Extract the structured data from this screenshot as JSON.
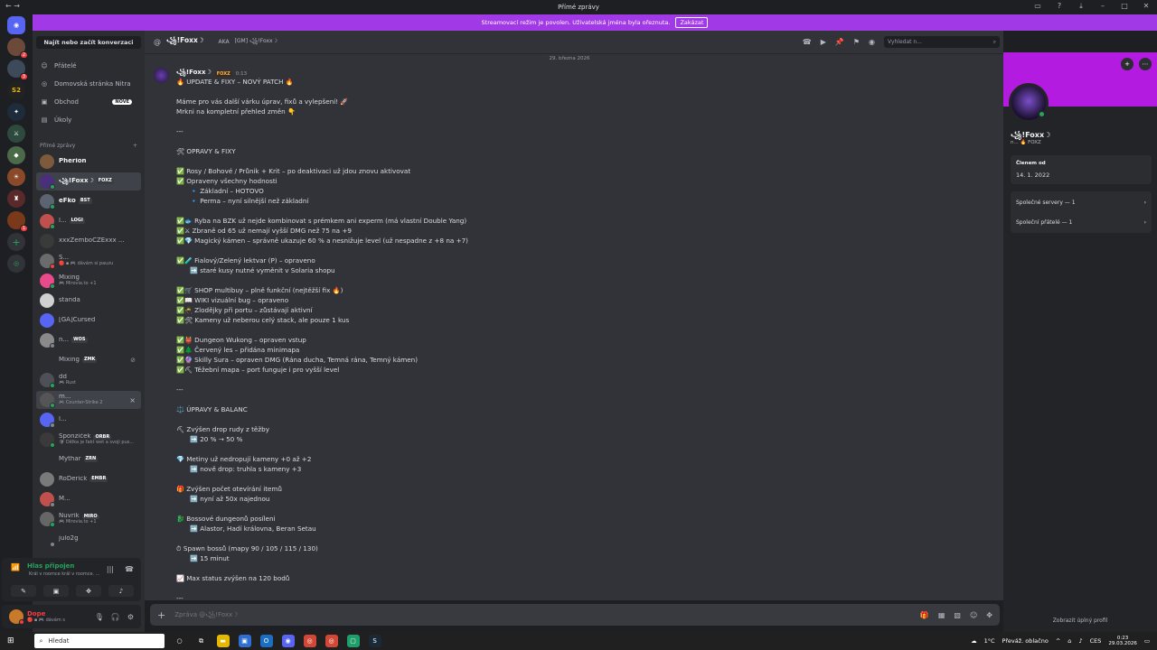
{
  "window": {
    "title": "Přímé zprávy"
  },
  "banner": {
    "text": "Streamovací režim je povolen. Uživatelská jména byla ořeznuta.",
    "button": "Zakázat"
  },
  "dm_sidebar": {
    "search": "Najít nebo začít konverzaci",
    "nav": [
      {
        "label": "Přátelé",
        "icon": "friends-icon"
      },
      {
        "label": "Domovská stránka Nitra",
        "icon": "nitro-icon"
      },
      {
        "label": "Obchod",
        "icon": "shop-icon",
        "badge": "NOVÉ"
      },
      {
        "label": "Úkoly",
        "icon": "quests-icon"
      }
    ],
    "header": "Přímé zprávy",
    "header_plus": "+",
    "dms": [
      {
        "name": "Pherion",
        "bright": true,
        "color": "#7d5a3c",
        "status": "none"
      },
      {
        "name": "꧁!Foxx☽",
        "tag": "FOXZ",
        "selected": true,
        "bright": true,
        "color": "#4a2f7a",
        "status": "online"
      },
      {
        "name": "eFko",
        "tag": "BST",
        "bright": true,
        "color": "#5b6470",
        "status": "online"
      },
      {
        "name": "l...",
        "tag": "LOGI",
        "color": "#c0504d",
        "status": "online"
      },
      {
        "name": "xxxZemboCZExxx ...",
        "color": "#3a3a3a",
        "status": "none"
      },
      {
        "name": "S...",
        "sub": "🔴 ▪ 🎮 dávám si pauzu",
        "color": "#6b6b6b",
        "status": "dnd"
      },
      {
        "name": "Mixing",
        "sub": "🎮 Mirovia.to +1",
        "color": "#e84a8a",
        "status": "online"
      },
      {
        "name": "standa",
        "color": "#d0d0d0",
        "status": "none"
      },
      {
        "name": "[GA]Cursed",
        "color": "#5865f2",
        "status": "none"
      },
      {
        "name": "n...",
        "tag": "WOS",
        "color": "#8a8a8a",
        "status": "offline"
      },
      {
        "name": "Mixing",
        "tag": "ZMK",
        "color": "#2b2d31",
        "status": "none",
        "muted": true
      },
      {
        "name": "dd",
        "sub": "🎮 Rust",
        "color": "#4e5058",
        "status": "online"
      },
      {
        "name": "m...",
        "sub": "🎮 Counter-Strike 2",
        "color": "#555",
        "status": "online",
        "hover": true,
        "close": "×"
      },
      {
        "name": "l...",
        "color": "#5865f2",
        "status": "offline"
      },
      {
        "name": "Sponzíček",
        "tag": "ORBR",
        "sub": "🛡 Dělka je fakt wet a svoji pus...",
        "color": "#3a3a3a",
        "status": "online"
      },
      {
        "name": "Mythar",
        "tag": "ZRN",
        "color": "#2b2d31",
        "status": "none"
      },
      {
        "name": "RoDerick",
        "tag": "EMBR",
        "color": "#7a7a7a",
        "status": "none"
      },
      {
        "name": "M...",
        "color": "#c0504d",
        "status": "offline"
      },
      {
        "name": "Nuvrik",
        "tag": "MIRO",
        "sub": "🎮 Mirovia.to +1",
        "color": "#666",
        "status": "online"
      },
      {
        "name": "julo2g",
        "color": "#2b2d31",
        "status": "offline"
      }
    ]
  },
  "voice": {
    "title": "Hlas připojen",
    "sub": "Král v roomce král v roomce. ..."
  },
  "user": {
    "name": "Dope",
    "status": "🔴 ▪ 🎮 dávám s"
  },
  "chat_header": {
    "name": "꧁!Foxx☽",
    "aka_label": "AKA",
    "aka_value": "[GM] ꧁!Foxx☽",
    "search": "Vyhledat n..."
  },
  "message": {
    "date": "29. března 2026",
    "author": "꧁!Foxx☽",
    "tag": "FOXZ",
    "time": "0:13",
    "lines": [
      {
        "t": "🔥 UPDATE & FIXY – NOVÝ PATCH 🔥"
      },
      {
        "t": ""
      },
      {
        "t": "Máme pro vás další várku úprav, fixů a vylepšení! 🚀"
      },
      {
        "t": "Mrkni na kompletní přehled změn 👇"
      },
      {
        "t": ""
      },
      {
        "t": "---"
      },
      {
        "t": ""
      },
      {
        "t": "🛠 OPRAVY & FIXY"
      },
      {
        "t": ""
      },
      {
        "t": "✅ Rosy / Bohové / Průnik + Krit – po deaktivaci už jdou znovu aktivovat"
      },
      {
        "t": "✅ Opraveny všechny hodnosti"
      },
      {
        "t": "🔹 Základní – HOTOVO",
        "ind": true
      },
      {
        "t": "🔹 Perma – nyní silnější než základní",
        "ind": true
      },
      {
        "t": ""
      },
      {
        "t": "✅🐟 Ryba na BZK už nejde kombinovat s prémkem ani experm (má vlastní Double Yang)"
      },
      {
        "t": "✅⚔ Zbraně od 65 už nemají vyšší DMG než 75 na +9"
      },
      {
        "t": "✅💎 Magický kámen – správně ukazuje 60 % a nesnižuje level (už nespadne z +8 na +7)"
      },
      {
        "t": ""
      },
      {
        "t": "✅🧪 Fialový/Zelený lektvar (P) – opraveno"
      },
      {
        "t": "➡️ staré kusy nutné vyměnit v Solaria shopu",
        "ind": true
      },
      {
        "t": ""
      },
      {
        "t": "✅🛒 SHOP multibuy – plně funkční (nejtěžší fix 🔥)"
      },
      {
        "t": "✅📖 WIKI vizuální bug – opraveno"
      },
      {
        "t": "✅🥷 Zlodějky při portu – zůstávají aktivní"
      },
      {
        "t": "✅🛠 Kameny už neberou celý stack, ale pouze 1 kus"
      },
      {
        "t": ""
      },
      {
        "t": "✅👹 Dungeon Wukong – opraven vstup"
      },
      {
        "t": "✅🌲 Červený les – přidána minimapa"
      },
      {
        "t": "✅🔮 Skilly Sura – opraven DMG (Rána ducha, Temná rána, Temný kámen)"
      },
      {
        "t": "✅⛏ Těžební mapa – port funguje i pro vyšší level"
      },
      {
        "t": ""
      },
      {
        "t": "---"
      },
      {
        "t": ""
      },
      {
        "t": "⚖️ ÚPRAVY & BALANC"
      },
      {
        "t": ""
      },
      {
        "t": "⛏ Zvýšen drop rudy z těžby"
      },
      {
        "t": "➡️ 20 % → 50 %",
        "ind": true
      },
      {
        "t": ""
      },
      {
        "t": "💎 Metiny už nedropují kameny +0 až +2"
      },
      {
        "t": "➡️ nově drop: truhla s kameny +3",
        "ind": true
      },
      {
        "t": ""
      },
      {
        "t": "🎁 Zvýšen počet otevírání itemů"
      },
      {
        "t": "➡️ nyní až 50x najednou",
        "ind": true
      },
      {
        "t": ""
      },
      {
        "t": "🐉 Bossové dungeonů posíleni"
      },
      {
        "t": "➡️ Alastor, Hadí královna, Beran Setau",
        "ind": true
      },
      {
        "t": ""
      },
      {
        "t": "⏱ Spawn bossů (mapy 90 / 105 / 115 / 130)"
      },
      {
        "t": "➡️ 15 minut",
        "ind": true
      },
      {
        "t": ""
      },
      {
        "t": "📈 Max status zvýšen na 120 bodů"
      },
      {
        "t": ""
      },
      {
        "t": "---"
      }
    ]
  },
  "composer": {
    "placeholder": "Zpráva @꧁!Foxx☽"
  },
  "profile": {
    "name": "꧁!Foxx☽",
    "sub": "n... 🔥 FOXZ",
    "member_label": "Členem od",
    "member_since": "14. 1. 2022",
    "servers": "Společné servery — 1",
    "friends": "Společní přátelé — 1",
    "full": "Zobrazit úplný profil",
    "banner_color": "#b31be0"
  },
  "taskbar": {
    "search": "Hledat",
    "weather": "1°C",
    "weather_text": "Převáž. oblačno",
    "lang": "CES",
    "time": "0:23",
    "date": "29.03.2026"
  },
  "colors": {
    "accent": "#a239e6",
    "online": "#23a55a",
    "dnd": "#f23f43",
    "blurple": "#5865f2"
  }
}
